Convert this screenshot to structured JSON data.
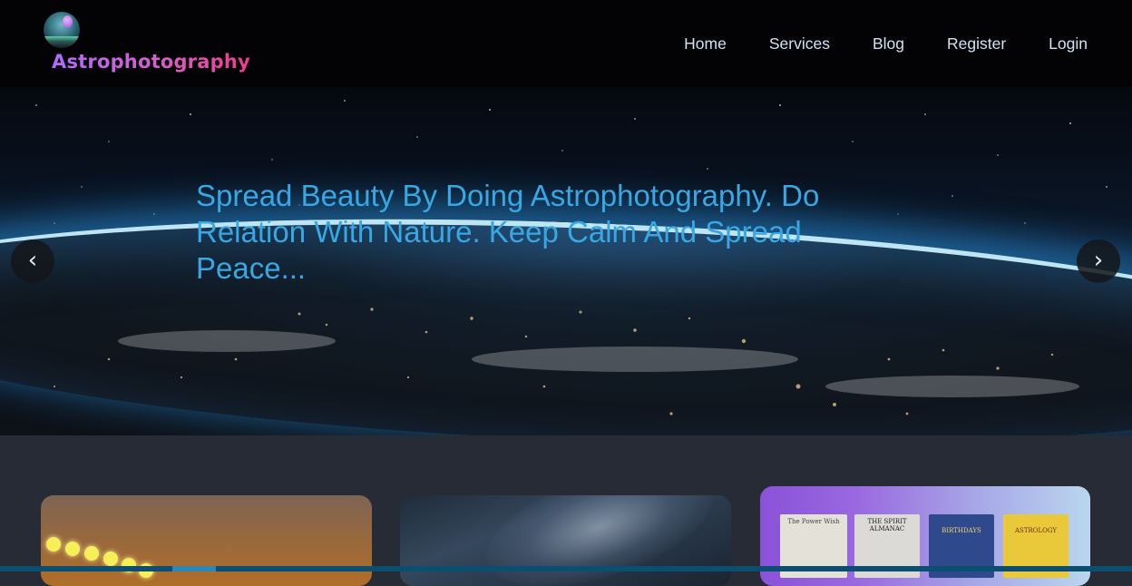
{
  "brand": {
    "name": "Astrophotography",
    "logo_icon": "planet-logo-icon"
  },
  "nav": {
    "items": [
      {
        "label": "Home"
      },
      {
        "label": "Services"
      },
      {
        "label": "Blog"
      },
      {
        "label": "Register"
      },
      {
        "label": "Login"
      }
    ]
  },
  "hero": {
    "caption": "Spread Beauty By Doing Astrophotography. Do Relation With Nature. Keep Calm And Spread Peace...",
    "prev_symbol": "‹",
    "next_symbol": "›"
  },
  "books": [
    {
      "title": "The Power Wish"
    },
    {
      "title": "THE SPIRIT ALMANAC"
    },
    {
      "title": "BIRTHDAYS"
    },
    {
      "title": "ASTROLOGY"
    }
  ],
  "colors": {
    "navbar_bg": "#030305",
    "page_bg": "#272b36",
    "hero_text": "#38a7e4",
    "nav_link": "#cfe3f4",
    "brand_gradient_start": "#b06cff",
    "brand_gradient_end": "#ef3c8c"
  }
}
